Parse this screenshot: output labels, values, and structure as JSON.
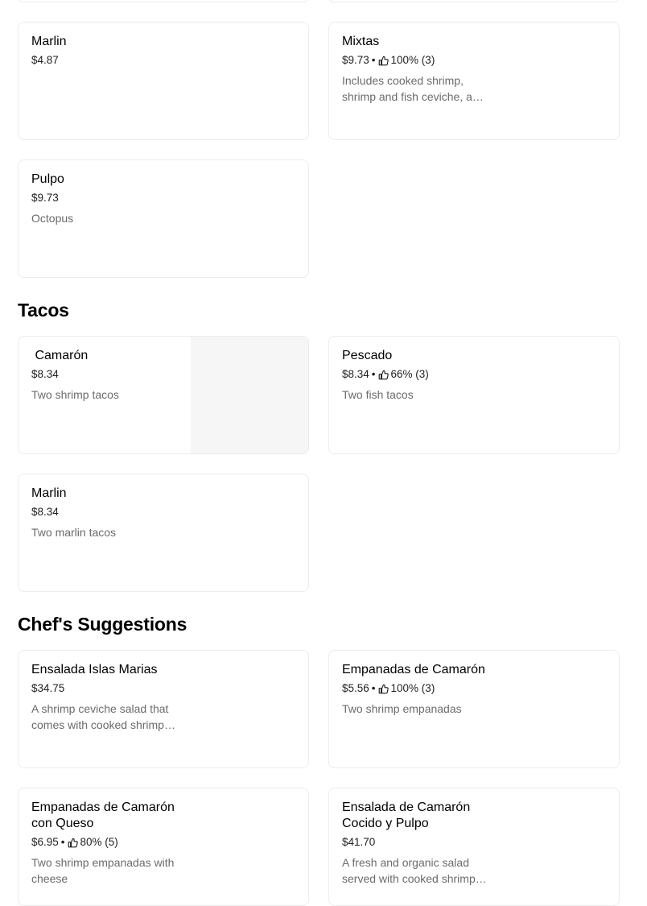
{
  "sections": [
    {
      "items": [
        {
          "name": "Marlin",
          "price": "$4.87",
          "rating": "",
          "desc": ""
        },
        {
          "name": "Mixtas",
          "price": "$9.73",
          "rating": "100% (3)",
          "desc": "Includes cooked shrimp, shrimp and fish ceviche, a…"
        },
        {
          "name": "Pulpo",
          "price": "$9.73",
          "rating": "",
          "desc": "Octopus"
        }
      ]
    },
    {
      "title": "Tacos",
      "items": [
        {
          "name": " Camarón",
          "price": "$8.34",
          "rating": "",
          "desc": "Two shrimp tacos"
        },
        {
          "name": "Pescado",
          "price": "$8.34",
          "rating": "66% (3)",
          "desc": "Two fish tacos"
        },
        {
          "name": "Marlin",
          "price": "$8.34",
          "rating": "",
          "desc": "Two marlin tacos"
        }
      ]
    },
    {
      "title": "Chef's Suggestions",
      "items": [
        {
          "name": "Ensalada Islas Marias",
          "price": "$34.75",
          "rating": "",
          "desc": "A shrimp ceviche salad that comes with cooked shrimp…"
        },
        {
          "name": "Empanadas de Camarón",
          "price": "$5.56",
          "rating": "100% (3)",
          "desc": "Two shrimp empanadas"
        },
        {
          "name": "Empanadas de Camarón con Queso",
          "price": "$6.95",
          "rating": "80% (5)",
          "desc": "Two shrimp empanadas with cheese"
        },
        {
          "name": "Ensalada de Camarón Cocido y Pulpo",
          "price": "$41.70",
          "rating": "",
          "desc": "A fresh and organic salad served with cooked shrimp…"
        }
      ]
    }
  ],
  "icons": {
    "rating": "thumbs-up-icon"
  },
  "colors": {
    "border": "#ececec",
    "muted_text": "#6b6b6b",
    "image_placeholder": "#f6f6f6"
  }
}
